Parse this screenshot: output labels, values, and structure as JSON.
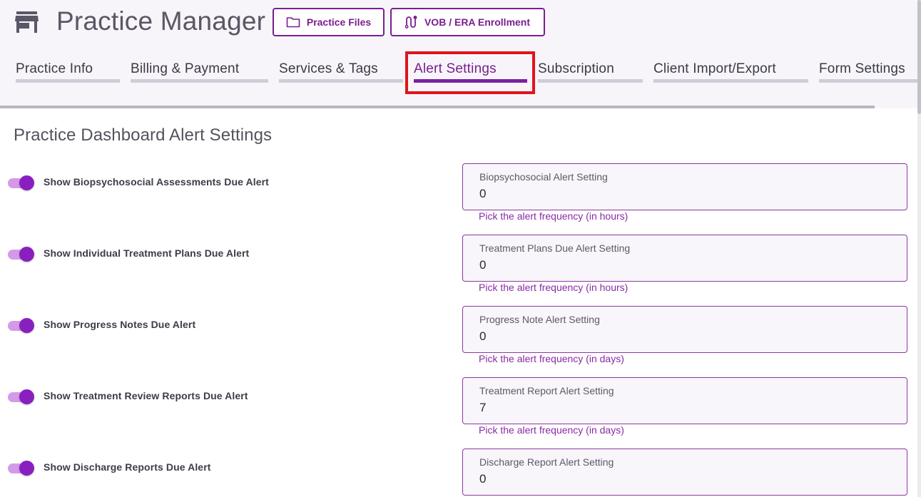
{
  "app": {
    "title": "Practice Manager",
    "icon": "store-icon"
  },
  "header_buttons": {
    "practice_files": {
      "label": "Practice Files",
      "icon": "folder-icon"
    },
    "vob_era": {
      "label": "VOB / ERA Enrollment",
      "icon": "route-icon"
    }
  },
  "tabs": [
    {
      "label": "Practice Info",
      "active": false
    },
    {
      "label": "Billing & Payment",
      "active": false
    },
    {
      "label": "Services & Tags",
      "active": false
    },
    {
      "label": "Alert Settings",
      "active": true
    },
    {
      "label": "Subscription",
      "active": false
    },
    {
      "label": "Client Import/Export",
      "active": false
    },
    {
      "label": "Form Settings",
      "active": false
    }
  ],
  "section": {
    "title": "Practice Dashboard Alert Settings"
  },
  "alerts": [
    {
      "toggle_label": "Show Biopsychosocial Assessments Due Alert",
      "enabled": true,
      "field_label": "Biopsychosocial Alert Setting",
      "value": "0",
      "hint": "Pick the alert frequency (in hours)"
    },
    {
      "toggle_label": "Show Individual Treatment Plans Due Alert",
      "enabled": true,
      "field_label": "Treatment Plans Due Alert Setting",
      "value": "0",
      "hint": "Pick the alert frequency (in hours)"
    },
    {
      "toggle_label": "Show Progress Notes Due Alert",
      "enabled": true,
      "field_label": "Progress Note Alert Setting",
      "value": "0",
      "hint": "Pick the alert frequency (in days)"
    },
    {
      "toggle_label": "Show Treatment Review Reports Due Alert",
      "enabled": true,
      "field_label": "Treatment Report Alert Setting",
      "value": "7",
      "hint": "Pick the alert frequency (in days)"
    },
    {
      "toggle_label": "Show Discharge Reports Due Alert",
      "enabled": true,
      "field_label": "Discharge Report Alert Setting",
      "value": "0",
      "hint": ""
    }
  ],
  "colors": {
    "accent": "#7a1f8f",
    "active_tab_bar": "#7b21a2",
    "toggle_knob": "#8a1fbf",
    "toggle_track": "#d49ae8",
    "highlight": "#e0141b"
  }
}
